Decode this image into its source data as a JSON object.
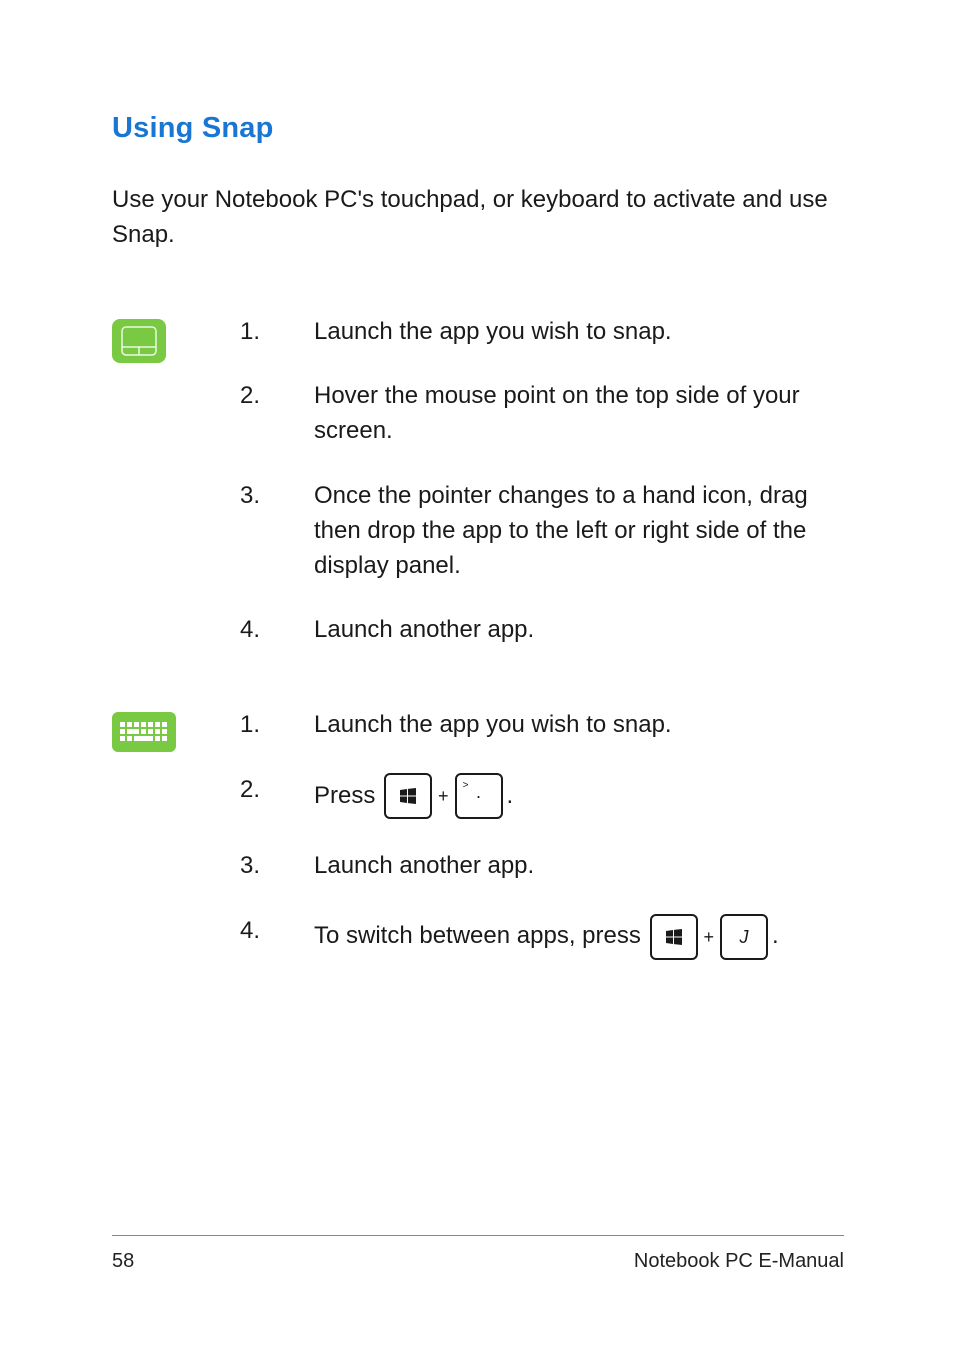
{
  "section_title": "Using Snap",
  "intro": "Use your Notebook PC's touchpad, or keyboard to activate and use Snap.",
  "touchpad": {
    "icon_name": "touchpad-icon",
    "steps": [
      {
        "num": "1.",
        "text": "Launch the app you wish to snap."
      },
      {
        "num": "2.",
        "text": "Hover the mouse point on the top side of your screen."
      },
      {
        "num": "3.",
        "text": "Once the pointer changes to a hand icon, drag then drop the app to the left or right side of the display panel."
      },
      {
        "num": "4.",
        "text": "Launch another app."
      }
    ]
  },
  "keyboard": {
    "icon_name": "keyboard-icon",
    "steps": [
      {
        "num": "1.",
        "text": "Launch the app you wish to snap."
      },
      {
        "num": "2.",
        "prefix": "Press ",
        "key1": "windows-key-icon",
        "plus": "+",
        "key2_sup": ">",
        "key2_center": "·",
        "suffix": "."
      },
      {
        "num": "3.",
        "text": "Launch another app."
      },
      {
        "num": "4.",
        "prefix": "To switch between apps, press ",
        "key1": "windows-key-icon",
        "plus": "+",
        "key2_letter": "J",
        "suffix": "."
      }
    ]
  },
  "footer": {
    "page": "58",
    "title": "Notebook PC E-Manual"
  }
}
